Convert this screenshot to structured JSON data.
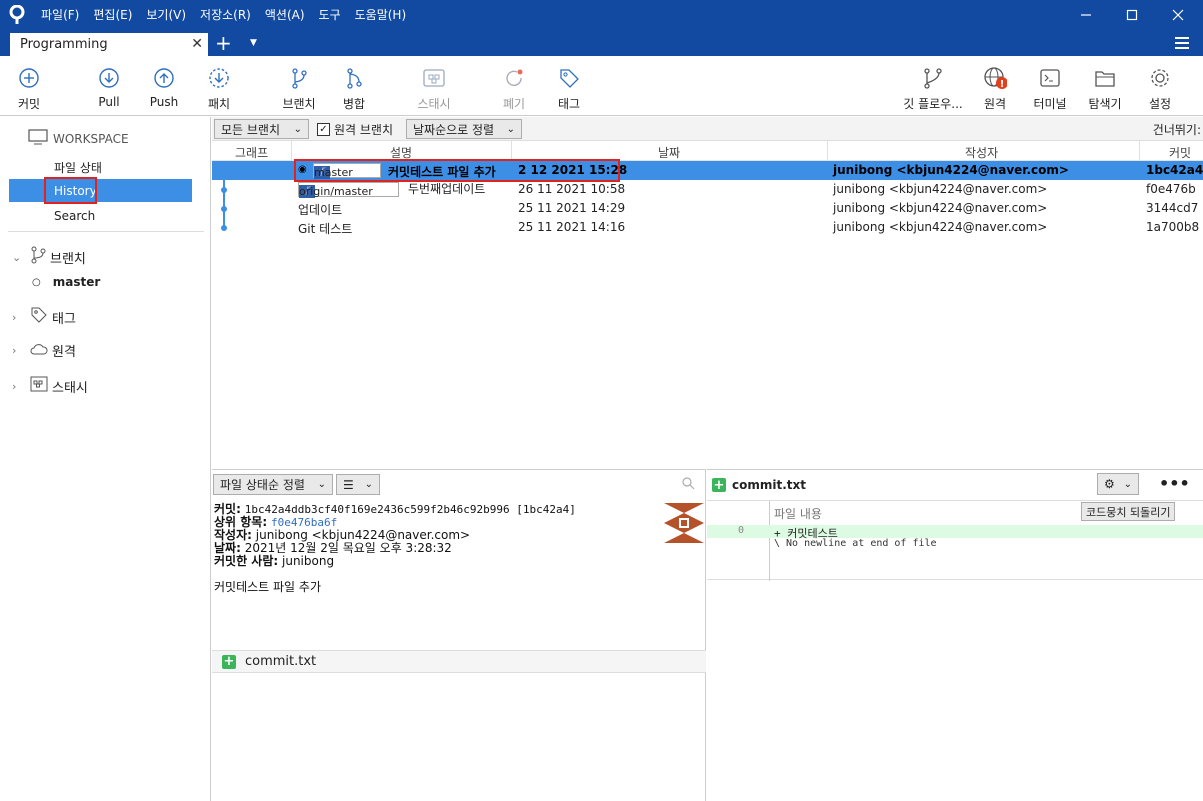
{
  "menu": [
    "파일(F)",
    "편집(E)",
    "보기(V)",
    "저장소(R)",
    "액션(A)",
    "도구",
    "도움말(H)"
  ],
  "tab": {
    "title": "Programming"
  },
  "toolbar": {
    "commit": "커밋",
    "pull": "Pull",
    "push": "Push",
    "fetch": "패치",
    "branch": "브랜치",
    "merge": "병합",
    "stash": "스태시",
    "discard": "폐기",
    "tag": "태그",
    "gitflow": "깃 플로우...",
    "remote": "원격",
    "terminal": "터미널",
    "explorer": "탐색기",
    "settings": "설정"
  },
  "sidebar": {
    "workspace": "WORKSPACE",
    "file_status": "파일 상태",
    "history": "History",
    "search": "Search",
    "branches": "브랜치",
    "branch_master": "master",
    "tags": "태그",
    "remotes": "원격",
    "stashes": "스태시"
  },
  "filter": {
    "all_branches": "모든 브랜치",
    "remote_branches": "원격 브랜치",
    "sort_date": "날짜순으로 정렬",
    "jump": "건너뛰기:"
  },
  "columns": {
    "graph": "그래프",
    "desc": "설명",
    "date": "날짜",
    "author": "작성자",
    "commit": "커밋"
  },
  "commits": [
    {
      "ref": "master",
      "desc": "커밋테스트 파일 추가",
      "date": "2 12 2021 15:28",
      "author": "junibong <kbjun4224@naver.com>",
      "hash": "1bc42a4"
    },
    {
      "ref": "origin/master",
      "desc": "두번째업데이트",
      "date": "26 11 2021 10:58",
      "author": "junibong <kbjun4224@naver.com>",
      "hash": "f0e476b"
    },
    {
      "ref": "",
      "desc": "업데이트",
      "date": "25 11 2021 14:29",
      "author": "junibong <kbjun4224@naver.com>",
      "hash": "3144cd7"
    },
    {
      "ref": "",
      "desc": "Git 테스트",
      "date": "25 11 2021 14:16",
      "author": "junibong <kbjun4224@naver.com>",
      "hash": "1a700b8"
    }
  ],
  "lower_left": {
    "sort": "파일 상태순 정렬",
    "commit_line_label": "커밋:",
    "commit_line_value": "1bc42a4ddb3cf40f169e2436c599f2b46c92b996 [1bc42a4]",
    "parent_label": "상위 항목:",
    "parent_value": "f0e476ba6f",
    "author_label": "작성자:",
    "author_value": "junibong <kbjun4224@naver.com>",
    "date_label": "날짜:",
    "date_value": "2021년 12월 2일 목요일 오후 3:28:32",
    "committer_label": "커밋한 사람:",
    "committer_value": "junibong",
    "message": "커밋테스트 파일 추가",
    "file": "commit.txt"
  },
  "lower_right": {
    "file": "commit.txt",
    "file_content": "파일 내용",
    "revert_hunk": "코드뭉치 되돌리기",
    "line_no": "0",
    "line1": "+ 커밋테스트",
    "line2": "\\ No newline at end of file"
  },
  "colors": {
    "titlebar": "#114aa0",
    "selection": "#3d8ee5",
    "highlight": "#e0231c"
  }
}
